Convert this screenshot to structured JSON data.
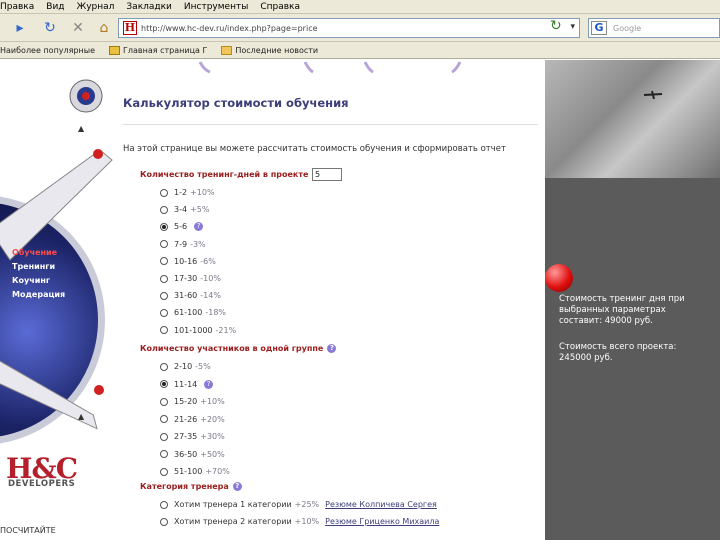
{
  "browser": {
    "menu": [
      "Правка",
      "Вид",
      "Журнал",
      "Закладки",
      "Инструменты",
      "Справка"
    ],
    "address": "http://www.hc-dev.ru/index.php?page=price",
    "search_placeholder": "Google",
    "bookmarks": [
      "Наиболее популярные",
      "Главная страница Г",
      "Последние новости"
    ]
  },
  "sidebar": {
    "nav": [
      "Обучение",
      "Тренинги",
      "Коучинг",
      "Модерация"
    ],
    "logo_main": "H&C",
    "logo_sub": "DEVELOPERS",
    "bottom_text": "ПОСЧИТАЙТЕ"
  },
  "calc": {
    "title": "Калькулятор стоимости обучения",
    "intro": "На этой странице вы можете рассчитать стоимость обучения и сформировать отчет",
    "days_label": "Количество тренинг-дней в проекте",
    "days_value": "5",
    "days_options": [
      {
        "label": "1-2",
        "mod": "+10%"
      },
      {
        "label": "3-4",
        "mod": "+5%"
      },
      {
        "label": "5-6",
        "mod": ""
      },
      {
        "label": "7-9",
        "mod": "-3%"
      },
      {
        "label": "10-16",
        "mod": "-6%"
      },
      {
        "label": "17-30",
        "mod": "-10%"
      },
      {
        "label": "31-60",
        "mod": "-14%"
      },
      {
        "label": "61-100",
        "mod": "-18%"
      },
      {
        "label": "101-1000",
        "mod": "-21%"
      }
    ],
    "days_selected": 2,
    "group_label": "Количество участников в одной группе",
    "group_options": [
      {
        "label": "2-10",
        "mod": "-5%"
      },
      {
        "label": "11-14",
        "mod": ""
      },
      {
        "label": "15-20",
        "mod": "+10%"
      },
      {
        "label": "21-26",
        "mod": "+20%"
      },
      {
        "label": "27-35",
        "mod": "+30%"
      },
      {
        "label": "36-50",
        "mod": "+50%"
      },
      {
        "label": "51-100",
        "mod": "+70%"
      }
    ],
    "group_selected": 1,
    "trainer_label": "Категория тренера",
    "trainer_options": [
      {
        "label": "Хотим тренера 1 категории",
        "mod": "+25%",
        "link": "Резюме Колпичева Сергея"
      },
      {
        "label": "Хотим тренера 2 категории",
        "mod": "+10%",
        "link": "Резюме Гриценко Михаила"
      }
    ]
  },
  "result": {
    "line1": [
      "Стоимость тренинг дня при",
      "выбранных параметрах",
      "составит: 49000 руб."
    ],
    "line2": [
      "Стоимость всего проекта:",
      "245000 руб."
    ]
  }
}
